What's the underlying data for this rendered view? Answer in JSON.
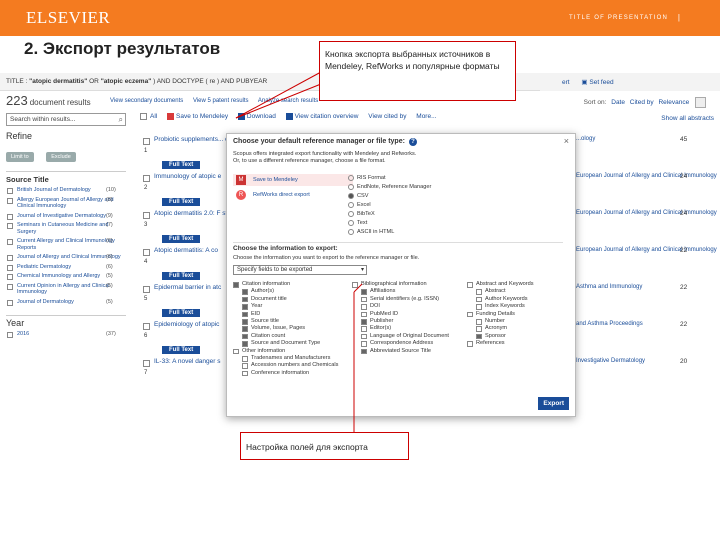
{
  "slide": {
    "logo": "ELSEVIER",
    "presentation_title": "TITLE OF PRESENTATION",
    "separator": "|",
    "heading": "2. Экспорт результатов"
  },
  "query": {
    "text_prefix": "TITLE : ",
    "term1": "\"atopic dermatitis\"",
    "or": " OR ",
    "term2": "\"atopic eczema\"",
    "text_suffix": " ) AND DOCTYPE ( re ) AND PUBYEAR",
    "links": [
      "ert",
      "Set feed"
    ]
  },
  "results": {
    "count": "223",
    "label": "document results",
    "actions": [
      "View secondary documents",
      "View 5 patent results",
      "Analyze search results"
    ],
    "sort_label": "Sort on:",
    "sort_options": [
      "Date",
      "Cited by",
      "Relevance"
    ],
    "search_within_placeholder": "Search within results...",
    "toolbar": [
      "All",
      "Save to Mendeley",
      "Download",
      "View citation overview",
      "View cited by",
      "More..."
    ],
    "show_abstracts": "Show all abstracts"
  },
  "sidebar": {
    "refine": "Refine",
    "limit_label": "Limit to",
    "exclude_label": "Exclude",
    "source_title_heading": "Source Title",
    "sources": [
      {
        "name": "British Journal of Dermatology",
        "count": "(10)"
      },
      {
        "name": "Allergy European Journal of Allergy and Clinical Immunology",
        "count": "(8)"
      },
      {
        "name": "Journal of Investigative Dermatology",
        "count": "(9)"
      },
      {
        "name": "Seminars in Cutaneous Medicine and Surgery",
        "count": "(7)"
      },
      {
        "name": "Current Allergy and Clinical Immunology Reports",
        "count": "(6)"
      },
      {
        "name": "Journal of Allergy and Clinical Immunology",
        "count": "(6)"
      },
      {
        "name": "Pediatric Dermatology",
        "count": "(6)"
      },
      {
        "name": "Chemical Immunology and Allergy",
        "count": "(5)"
      },
      {
        "name": "Current Opinion in Allergy and Clinical Immunology",
        "count": "(5)"
      },
      {
        "name": "Journal of Dermatology",
        "count": "(5)"
      }
    ],
    "year_heading": "Year",
    "year_first": "2016",
    "year_first_count": "(37)"
  },
  "rows": [
    {
      "num": "1",
      "title": "Probiotic supplements... dermatitis: A grab-and-",
      "source": "...ology",
      "cited": "45"
    },
    {
      "num": "2",
      "title": "Immunology of atopic e",
      "source": "European Journal of Allergy and Clinical Immunology",
      "cited": "24"
    },
    {
      "num": "3",
      "title": "Atopic dermatitis 2.0: F stratified medicine",
      "source": "European Journal of Allergy and Clinical Immunology",
      "cited": "24"
    },
    {
      "num": "4",
      "title": "Atopic dermatitis: A co",
      "source": "European Journal of Allergy and Clinical Immunology",
      "cited": "22"
    },
    {
      "num": "5",
      "title": "Epidermal barrier in atc",
      "source": "Asthma and Immunology",
      "cited": "22"
    },
    {
      "num": "6",
      "title": "Epidemiology of atopic",
      "source": "and Asthma Proceedings",
      "cited": "22"
    },
    {
      "num": "7",
      "title": "IL-33: A novel danger s",
      "source": "Investigative Dermatology",
      "cited": "20"
    }
  ],
  "full_text_label": "Full Text",
  "modal": {
    "title": "Choose your default reference manager or file type:",
    "help": "?",
    "close": "×",
    "intro1": "Scopus offers integrated export functionality with Mendeley and Refworks.",
    "intro2": "Or, to use a different reference manager, choose a file format.",
    "mendeley": "Save to Mendeley",
    "refworks": "RefWorks direct export",
    "formats": [
      {
        "label": "RIS Format",
        "selected": false
      },
      {
        "label": "EndNote, Reference Manager",
        "selected": false
      },
      {
        "label": "CSV",
        "selected": true
      },
      {
        "label": "Excel",
        "selected": false
      },
      {
        "label": "BibTeX",
        "selected": false
      },
      {
        "label": "Text",
        "selected": false
      },
      {
        "label": "ASCII in HTML",
        "selected": false
      }
    ],
    "choose_info": "Choose the information to export:",
    "choose_info_sub": "Choose the information you want to export to the reference manager or file.",
    "select_value": "Specify fields to be exported",
    "col1": [
      {
        "label": "Citation information",
        "checked": true,
        "sub": false
      },
      {
        "label": "Author(s)",
        "checked": true,
        "sub": true
      },
      {
        "label": "Document title",
        "checked": true,
        "sub": true
      },
      {
        "label": "Year",
        "checked": true,
        "sub": true
      },
      {
        "label": "EID",
        "checked": true,
        "sub": true
      },
      {
        "label": "Source title",
        "checked": true,
        "sub": true
      },
      {
        "label": "Volume, Issue, Pages",
        "checked": true,
        "sub": true
      },
      {
        "label": "Citation count",
        "checked": true,
        "sub": true
      },
      {
        "label": "Source and Document Type",
        "checked": true,
        "sub": true
      },
      {
        "label": "Other information",
        "checked": false,
        "sub": false
      },
      {
        "label": "Tradenames and Manufacturers",
        "checked": false,
        "sub": true
      },
      {
        "label": "Accession numbers and Chemicals",
        "checked": false,
        "sub": true
      },
      {
        "label": "Conference information",
        "checked": false,
        "sub": true
      }
    ],
    "col2": [
      {
        "label": "Bibliographical information",
        "checked": false,
        "sub": false
      },
      {
        "label": "Affiliations",
        "checked": true,
        "sub": true
      },
      {
        "label": "Serial identifiers (e.g. ISSN)",
        "checked": false,
        "sub": true
      },
      {
        "label": "DOI",
        "checked": false,
        "sub": true
      },
      {
        "label": "PubMed ID",
        "checked": false,
        "sub": true
      },
      {
        "label": "Publisher",
        "checked": true,
        "sub": true
      },
      {
        "label": "Editor(s)",
        "checked": false,
        "sub": true
      },
      {
        "label": "Language of Original Document",
        "checked": false,
        "sub": true
      },
      {
        "label": "Correspondence Address",
        "checked": false,
        "sub": true
      },
      {
        "label": "Abbreviated Source Title",
        "checked": true,
        "sub": true
      }
    ],
    "col3": [
      {
        "label": "Abstract and Keywords",
        "checked": false,
        "sub": false
      },
      {
        "label": "Abstract",
        "checked": false,
        "sub": true
      },
      {
        "label": "Author Keywords",
        "checked": false,
        "sub": true
      },
      {
        "label": "Index Keywords",
        "checked": false,
        "sub": true
      },
      {
        "label": "Funding Details",
        "checked": false,
        "sub": false
      },
      {
        "label": "Number",
        "checked": false,
        "sub": true
      },
      {
        "label": "Acronym",
        "checked": false,
        "sub": true
      },
      {
        "label": "Sponsor",
        "checked": true,
        "sub": true
      },
      {
        "label": "References",
        "checked": false,
        "sub": false
      }
    ],
    "export": "Export"
  },
  "callouts": {
    "top": "Кнопка экспорта выбранных источников в Mendeley, RefWorks и популярные форматы",
    "bottom": "Настройка полей для экспорта"
  },
  "colors": {
    "brand": "#f47b20",
    "link": "#1a4d99",
    "callout_border": "#cc0000"
  }
}
